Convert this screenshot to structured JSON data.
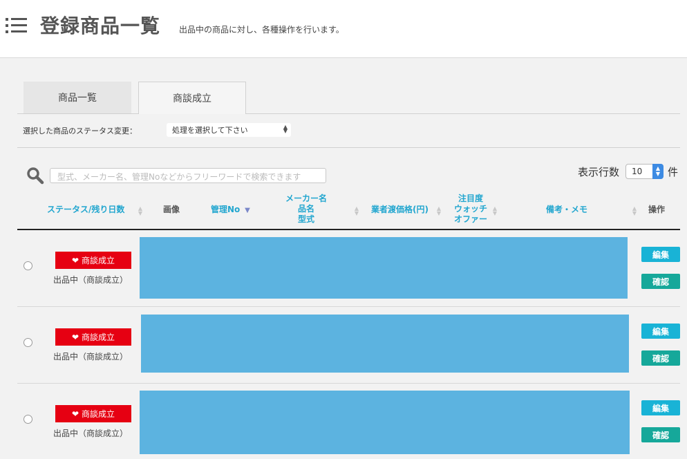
{
  "header": {
    "title": "登録商品一覧",
    "description": "出品中の商品に対し、各種操作を行います。"
  },
  "tabs": [
    {
      "label": "商品一覧",
      "active": false
    },
    {
      "label": "商談成立",
      "active": true
    }
  ],
  "bulk_status": {
    "label": "選択した商品のステータス変更：",
    "select_value": "処理を選択して下さい"
  },
  "search": {
    "placeholder": "型式、メーカー名、管理Noなどからフリーワードで検索できます"
  },
  "rows_per_page": {
    "label": "表示行数",
    "value": "10",
    "unit": "件"
  },
  "table": {
    "headers": {
      "status": "ステータス/残り日数",
      "image": "画像",
      "manage_no": "管理No",
      "maker_line1": "メーカー名",
      "maker_line2": "品名",
      "maker_line3": "型式",
      "price": "業者渡価格(円)",
      "watch_line1": "注目度",
      "watch_line2": "ウォッチ",
      "watch_line3": "オファー",
      "memo": "備考・メモ",
      "action": "操作"
    },
    "rows": [
      {
        "badge": "商談成立",
        "status": "出品中（商談成立）",
        "edit": "編集",
        "confirm": "確認"
      },
      {
        "badge": "商談成立",
        "status": "出品中（商談成立）",
        "edit": "編集",
        "confirm": "確認"
      },
      {
        "badge": "商談成立",
        "status": "出品中（商談成立）",
        "edit": "編集",
        "confirm": "確認"
      }
    ]
  },
  "colors": {
    "accent": "#22a6cf",
    "badge": "#e60012",
    "edit_button": "#19b3d6",
    "confirm_button": "#16a89a",
    "redacted_block": "#5cb3e0"
  },
  "icons": [
    "list-menu-icon",
    "search-icon",
    "heart-icon",
    "sort-arrows-icon"
  ]
}
